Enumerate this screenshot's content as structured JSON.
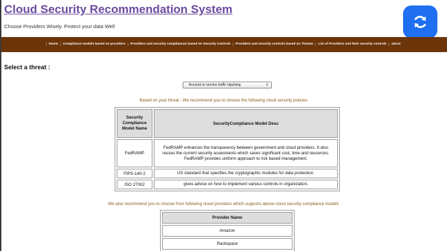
{
  "header": {
    "title": "Cloud Security Recommendation System",
    "tagline": "Choose Providers Wisely. Protect your data Well"
  },
  "refresh_icon": "refresh-icon",
  "colors": {
    "title": "#6a4ba0",
    "navbar": "#6b3409",
    "refresh_button": "#1f6ff0",
    "recommend_text": "#8a5a18"
  },
  "nav": {
    "items": [
      "Home",
      "Compliance models based on providers",
      "Providers and security compliances based on Security Controls",
      "Providers and security controls based on Threats",
      "List of Providers and their security controls",
      "about"
    ]
  },
  "threat": {
    "label": "Select a threat :",
    "selected": "Account or service traffic hijacking"
  },
  "policy_intro": "Based on your threat , We recommend you to choose the following cloud security policies",
  "policy_table": {
    "headers": [
      "Security Compliance Model Name",
      "SecurityCompliance Model Desc"
    ],
    "rows": [
      {
        "name": "FedRAMP",
        "desc": "FedRAMP enhances the transparency between government and cloud providers. It also reuses the current security assesments which saves significant cost, time and resources. FedRAMP provides uniform approach to risk based management."
      },
      {
        "name": "FIPS-140-2",
        "desc": "US standard that specifies the cryptographic modules for data protection."
      },
      {
        "name": "ISO 27002",
        "desc": "gives advice on how to implement various controls in organization."
      }
    ]
  },
  "provider_intro": "We also recommend you to choose from following cloud providers which supports above cloud security compliance models",
  "provider_table": {
    "header": "Provider Name",
    "rows": [
      "Amazon",
      "Rackspace"
    ]
  }
}
